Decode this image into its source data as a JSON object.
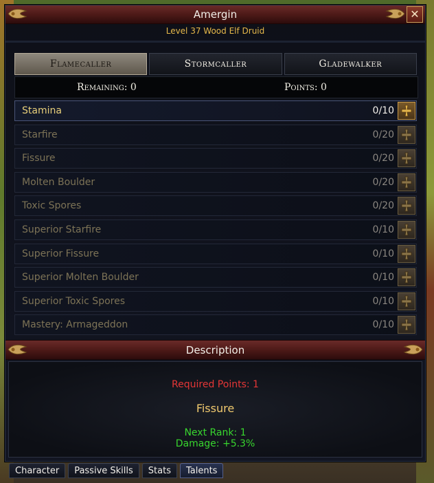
{
  "window": {
    "title": "Amergin",
    "subtitle": "Level 37 Wood Elf Druid",
    "close_glyph": "✕"
  },
  "tabs": [
    {
      "label": "Flamecaller",
      "active": true
    },
    {
      "label": "Stormcaller",
      "active": false
    },
    {
      "label": "Gladewalker",
      "active": false
    }
  ],
  "points": {
    "remaining": "Remaining: 0",
    "points": "Points: 0"
  },
  "talents": [
    {
      "name": "Stamina",
      "rank": "0/10",
      "active": true
    },
    {
      "name": "Starfire",
      "rank": "0/20"
    },
    {
      "name": "Fissure",
      "rank": "0/20"
    },
    {
      "name": "Molten Boulder",
      "rank": "0/20"
    },
    {
      "name": "Toxic Spores",
      "rank": "0/20"
    },
    {
      "name": "Superior Starfire",
      "rank": "0/10"
    },
    {
      "name": "Superior Fissure",
      "rank": "0/10"
    },
    {
      "name": "Superior Molten Boulder",
      "rank": "0/10"
    },
    {
      "name": "Superior Toxic Spores",
      "rank": "0/10"
    },
    {
      "name": "Mastery: Armageddon",
      "rank": "0/10"
    }
  ],
  "description": {
    "header": "Description",
    "required_points": "Required Points: 1",
    "talent_name": "Fissure",
    "next_rank": "Next Rank: 1",
    "damage": "Damage: +5.3%"
  },
  "bottom_tabs": [
    {
      "label": "Character"
    },
    {
      "label": "Passive Skills"
    },
    {
      "label": "Stats"
    },
    {
      "label": "Talents",
      "active": true
    }
  ],
  "colors": {
    "accent_gold": "#e6b84a",
    "required_red": "#e53636",
    "bonus_green": "#38d62e",
    "titlebar_red": "#4a1816"
  },
  "icons": {
    "add_talent": "plus-cross-icon",
    "ornament": "leaf-ornament-icon",
    "close": "close-icon"
  }
}
